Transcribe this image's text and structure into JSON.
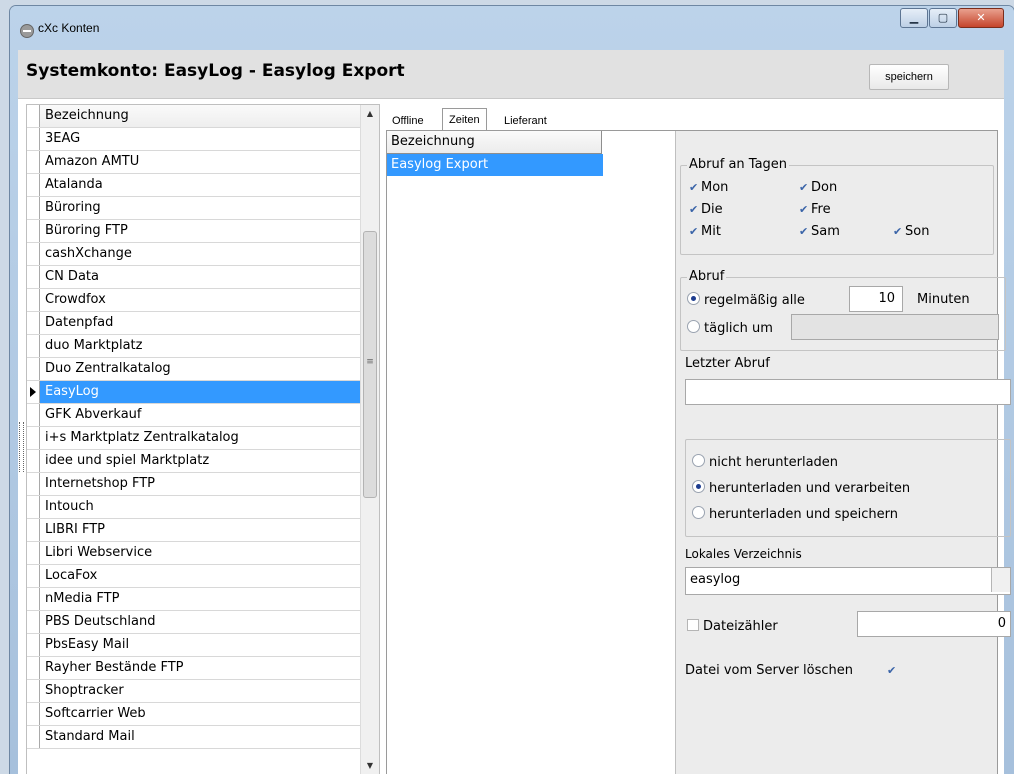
{
  "window": {
    "title": "cXc Konten",
    "minimize": "▁",
    "maximize": "▢",
    "close": "✕"
  },
  "header": {
    "title": "Systemkonto: EasyLog - Easylog Export",
    "save_label": "speichern"
  },
  "accounts": {
    "column_header": "Bezeichnung",
    "items": [
      "3EAG",
      "Amazon AMTU",
      "Atalanda",
      "Büroring",
      "Büroring FTP",
      "cashXchange",
      "CN Data",
      "Crowdfox",
      "Datenpfad",
      "duo Marktplatz",
      "Duo Zentralkatalog",
      "EasyLog",
      "GFK Abverkauf",
      "i+s Marktplatz Zentralkatalog",
      "idee und spiel Marktplatz",
      "Internetshop FTP",
      "Intouch",
      "LIBRI FTP",
      "Libri Webservice",
      "LocaFox",
      "nMedia FTP",
      "PBS Deutschland",
      "PbsEasy Mail",
      "Rayher Bestände FTP",
      "Shoptracker",
      "Softcarrier Web",
      "Standard Mail"
    ],
    "selected": "EasyLog"
  },
  "tabs": [
    "Offline",
    "Zeiten",
    "Lieferant"
  ],
  "active_tab": "Zeiten",
  "inner_list": {
    "column_header": "Bezeichnung",
    "selected_item": "Easylog Export"
  },
  "days": {
    "title": "Abruf an Tagen",
    "mon": "Mon",
    "die": "Die",
    "mit": "Mit",
    "don": "Don",
    "fre": "Fre",
    "sam": "Sam",
    "son": "Son",
    "check_mark": "✔"
  },
  "abruf": {
    "title": "Abruf",
    "regular_label": "regelmäßig alle",
    "minutes_value": "10",
    "minutes_unit": "Minuten",
    "daily_label": "täglich um",
    "selected": "regular"
  },
  "last_fetch": {
    "label": "Letzter Abruf",
    "value": ""
  },
  "download": {
    "opt_none": "nicht herunterladen",
    "opt_process": "herunterladen und verarbeiten",
    "opt_save": "herunterladen und speichern",
    "selected": "process"
  },
  "local_dir": {
    "label": "Lokales Verzeichnis",
    "value": "easylog"
  },
  "file_counter": {
    "label": "Dateizähler",
    "value": "0",
    "checked": false
  },
  "delete_from_server": {
    "label": "Datei vom Server löschen",
    "checked": true
  },
  "colors": {
    "selection": "#3399ff",
    "panel_bg": "#ececec",
    "check_blue": "#3a64a8"
  }
}
